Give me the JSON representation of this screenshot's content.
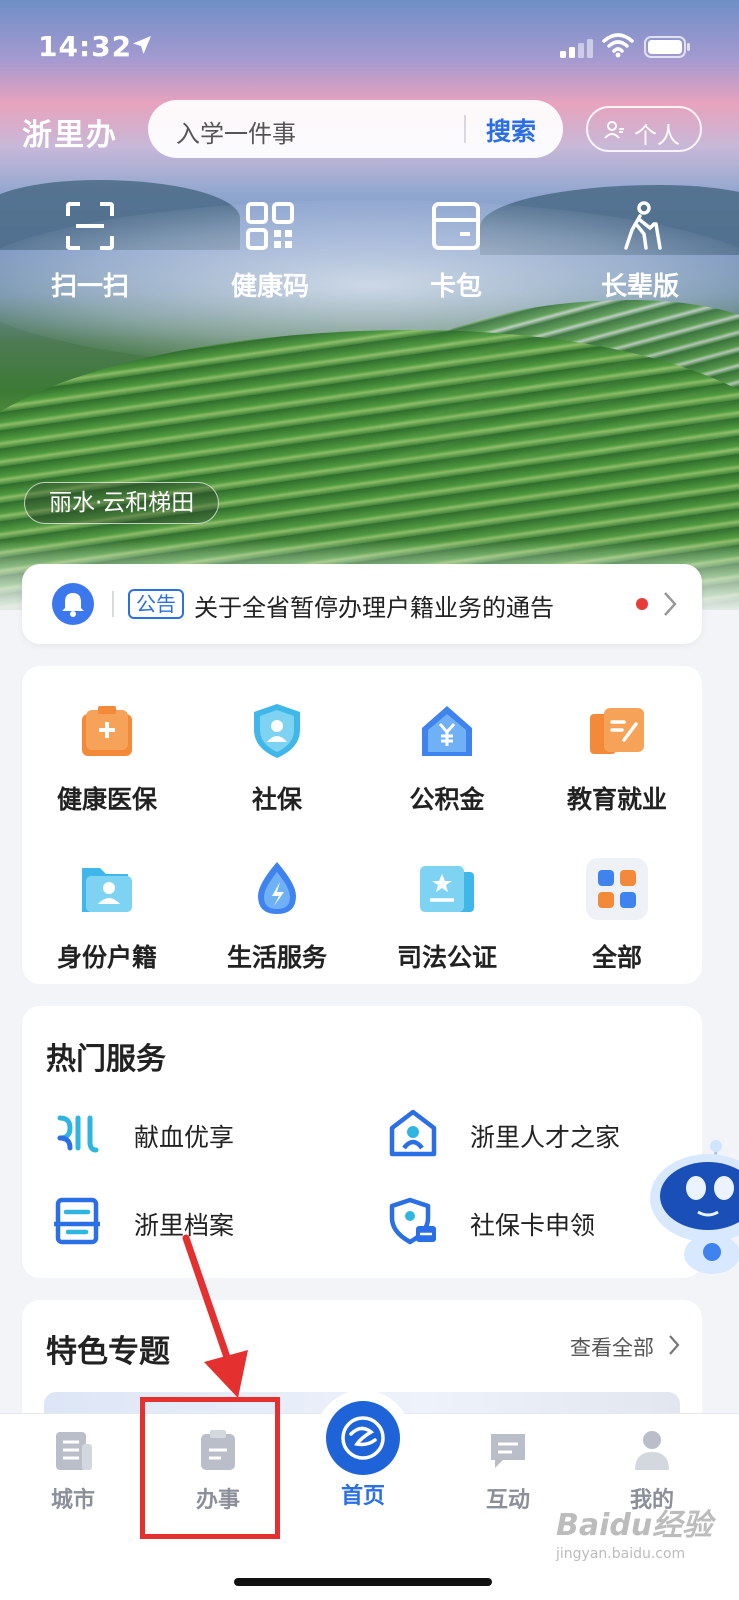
{
  "status_bar": {
    "time": "14:32"
  },
  "header": {
    "logo_text": "浙里办",
    "search_placeholder": "入学一件事",
    "search_button": "搜索",
    "personal_button": "个人"
  },
  "quick_actions": [
    {
      "label": "扫一扫",
      "icon": "scan-icon"
    },
    {
      "label": "健康码",
      "icon": "qr-code-icon"
    },
    {
      "label": "卡包",
      "icon": "card-wallet-icon"
    },
    {
      "label": "长辈版",
      "icon": "elder-icon"
    }
  ],
  "location_tag": "丽水·云和梯田",
  "notice": {
    "badge": "公告",
    "text": "关于全省暂停办理户籍业务的通告"
  },
  "services": [
    {
      "label": "健康医保",
      "icon": "health-insurance-icon"
    },
    {
      "label": "社保",
      "icon": "social-security-icon"
    },
    {
      "label": "公积金",
      "icon": "housing-fund-icon"
    },
    {
      "label": "教育就业",
      "icon": "education-employment-icon"
    },
    {
      "label": "身份户籍",
      "icon": "identity-icon"
    },
    {
      "label": "生活服务",
      "icon": "life-service-icon"
    },
    {
      "label": "司法公证",
      "icon": "notary-icon"
    },
    {
      "label": "全部",
      "icon": "all-apps-icon"
    }
  ],
  "hot_services": {
    "title": "热门服务",
    "items": [
      {
        "label": "献血优享",
        "icon": "blood-donation-icon"
      },
      {
        "label": "浙里人才之家",
        "icon": "talent-home-icon"
      },
      {
        "label": "浙里档案",
        "icon": "archive-icon"
      },
      {
        "label": "社保卡申领",
        "icon": "social-card-icon"
      }
    ]
  },
  "features": {
    "title": "特色专题",
    "more": "查看全部"
  },
  "tab_bar": [
    {
      "label": "城市",
      "icon": "city-icon"
    },
    {
      "label": "办事",
      "icon": "service-icon"
    },
    {
      "label": "首页",
      "icon": "home-logo-icon"
    },
    {
      "label": "互动",
      "icon": "chat-icon"
    },
    {
      "label": "我的",
      "icon": "profile-icon"
    }
  ],
  "watermark": {
    "line1": "Baidu经验",
    "line2": "jingyan.baidu.com"
  },
  "colors": {
    "accent": "#2b6fe6",
    "home_button": "#1f63d9",
    "annotation": "#e53030",
    "notice_dot": "#ea3b3b"
  }
}
